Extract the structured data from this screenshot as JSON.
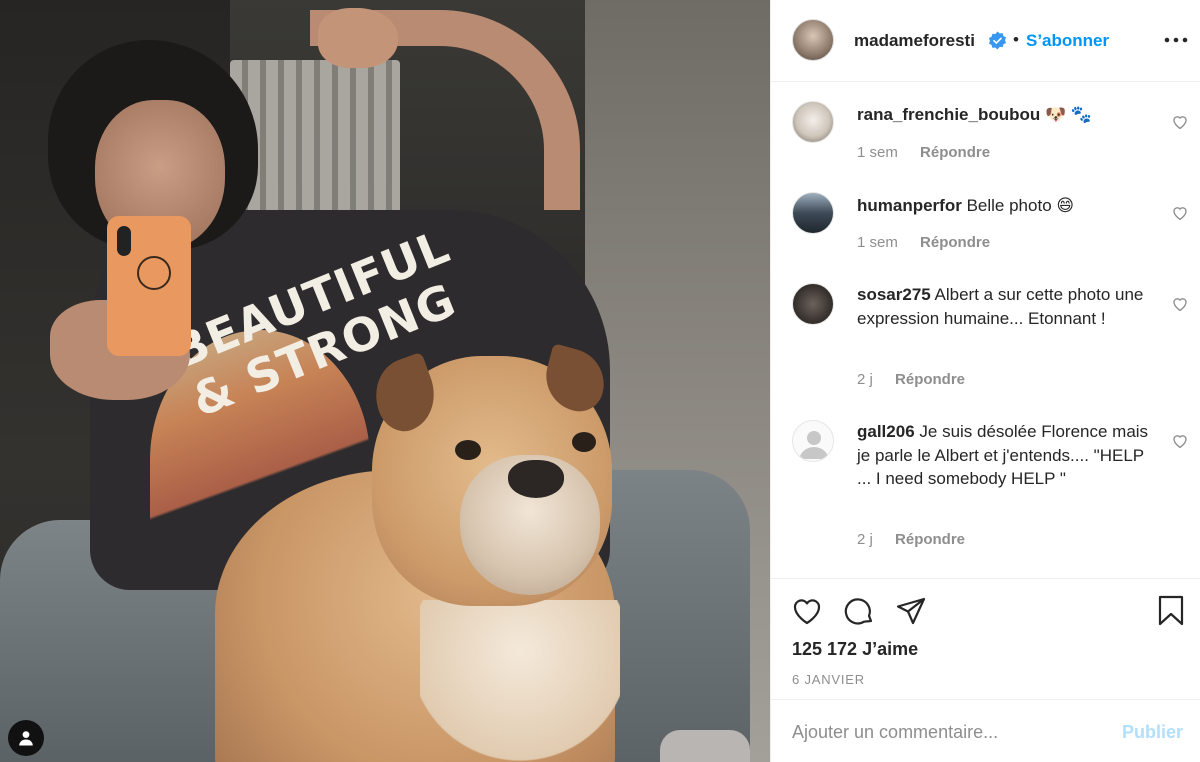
{
  "post": {
    "image_alt_icon": "person-icon",
    "shirt_text": [
      "BEAUTIFUL",
      "& STRONG"
    ]
  },
  "header": {
    "username": "madameforesti",
    "verified_icon": "verified-badge-icon",
    "separator": "•",
    "follow_label": "S’abonner",
    "more_icon": "more-horizontal-icon"
  },
  "comments": [
    {
      "user": "rana_frenchie_boubou",
      "text": "🐶 🐾",
      "time": "1 sem",
      "reply": "Répondre"
    },
    {
      "user": "humanperfor",
      "text": "Belle photo 😄",
      "time": "1 sem",
      "reply": "Répondre"
    },
    {
      "user": "sosar275",
      "text": "Albert a sur cette photo une expression humaine... Etonnant !",
      "time": "2 j",
      "reply": "Répondre"
    },
    {
      "user": "gall206",
      "text": "Je suis désolée Florence mais je parle le Albert et j'entends.... \"HELP ... I need somebody HELP \"",
      "time": "2 j",
      "reply": "Répondre"
    }
  ],
  "actions": {
    "like_icon": "heart-icon",
    "comment_icon": "comment-icon",
    "share_icon": "share-icon",
    "save_icon": "bookmark-icon",
    "likes": "125 172 J’aime",
    "date": "6 JANVIER"
  },
  "add_comment": {
    "placeholder": "Ajouter un commentaire...",
    "publish_label": "Publier"
  },
  "colors": {
    "accent": "#0095f6",
    "publish_disabled": "#b2dffc",
    "muted": "#8e8e8e",
    "text": "#262626"
  }
}
